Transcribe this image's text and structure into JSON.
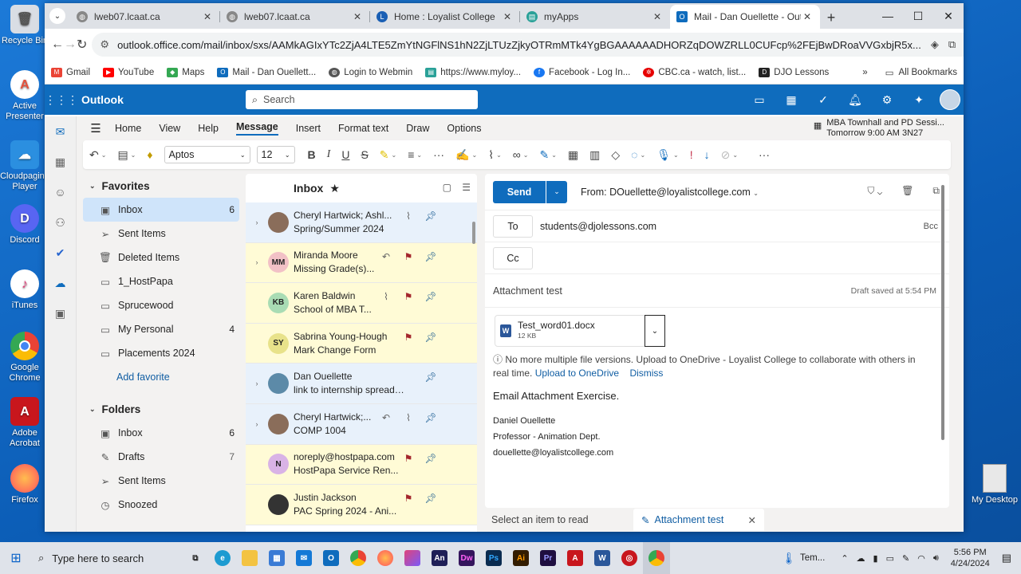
{
  "desktop": {
    "icons": [
      {
        "label": "Recycle Bin",
        "color": "#d9dde4",
        "glyph": "🗑"
      },
      {
        "label": "Active Presenter",
        "color": "#e5523c",
        "glyph": "A"
      },
      {
        "label": "Cloudpaging Player",
        "color": "#2b8fe0",
        "glyph": "☁"
      },
      {
        "label": "Discord",
        "color": "#5865f2",
        "glyph": "D"
      },
      {
        "label": "iTunes",
        "color": "#f0f0f0",
        "glyph": "♪"
      },
      {
        "label": "Google Chrome",
        "color": "#e8453c",
        "glyph": "●"
      },
      {
        "label": "Adobe Acrobat",
        "color": "#c8161d",
        "glyph": "A"
      },
      {
        "label": "Firefox",
        "color": "#ff7139",
        "glyph": "●"
      }
    ],
    "right_icon": "My Desktop"
  },
  "browser": {
    "tabs": [
      {
        "title": "lweb07.lcaat.ca",
        "color": "#888"
      },
      {
        "title": "lweb07.lcaat.ca",
        "color": "#888"
      },
      {
        "title": "Home : Loyalist College",
        "color": "#1a5fb4"
      },
      {
        "title": "myApps",
        "color": "#2aa198"
      },
      {
        "title": "Mail - Dan Ouellette - Outlo",
        "color": "#0f6cbd"
      }
    ],
    "url": "outlook.office.com/mail/inbox/sxs/AAMkAGIxYTc2ZjA4LTE5ZmYtNGFlNS1hN2ZjLTUzZjkyOTRmMTk4YgBGAAAAAADHORZqDOWZRLL0CUFcp%2FEjBwDRoaVVGxbjR5x...",
    "bookmarks": [
      {
        "label": "Gmail",
        "color": "#ea4335"
      },
      {
        "label": "YouTube",
        "color": "#ff0000"
      },
      {
        "label": "Maps",
        "color": "#34a853"
      },
      {
        "label": "Mail - Dan Ouellett...",
        "color": "#0f6cbd"
      },
      {
        "label": "Login to Webmin",
        "color": "#555555"
      },
      {
        "label": "https://www.myloy...",
        "color": "#2aa198"
      },
      {
        "label": "Facebook - Log In...",
        "color": "#1877f2"
      },
      {
        "label": "CBC.ca - watch, list...",
        "color": "#e60000"
      },
      {
        "label": "DJO Lessons",
        "color": "#222222"
      }
    ],
    "all_bookmarks": "All Bookmarks"
  },
  "outlook": {
    "app_name": "Outlook",
    "search_placeholder": "Search",
    "ribbon_tabs": [
      "Home",
      "View",
      "Help",
      "Message",
      "Insert",
      "Format text",
      "Draw",
      "Options"
    ],
    "active_tab": "Message",
    "event": {
      "title": "MBA Townhall and PD Sessi...",
      "when": "Tomorrow 9:00 AM 3N27"
    },
    "font": "Aptos",
    "font_size": "12",
    "favorites_label": "Favorites",
    "favorites": [
      {
        "label": "Inbox",
        "count": "6",
        "icon": "inbox-icon",
        "glyph": "▣"
      },
      {
        "label": "Sent Items",
        "count": "",
        "icon": "sent-icon",
        "glyph": "➢"
      },
      {
        "label": "Deleted Items",
        "count": "",
        "icon": "trash-icon",
        "glyph": "🗑"
      },
      {
        "label": "1_HostPapa",
        "count": "",
        "icon": "folder-icon",
        "glyph": "▭"
      },
      {
        "label": "Sprucewood",
        "count": "",
        "icon": "folder-icon",
        "glyph": "▭"
      },
      {
        "label": "My Personal",
        "count": "4",
        "icon": "folder-icon",
        "glyph": "▭"
      },
      {
        "label": "Placements 2024",
        "count": "",
        "icon": "folder-icon",
        "glyph": "▭"
      }
    ],
    "add_favorite": "Add favorite",
    "folders_label": "Folders",
    "folders": [
      {
        "label": "Inbox",
        "count": "6",
        "icon": "inbox-icon",
        "glyph": "▣"
      },
      {
        "label": "Drafts",
        "count": "7",
        "icon": "drafts-icon",
        "glyph": "✎"
      },
      {
        "label": "Sent Items",
        "count": "",
        "icon": "sent-icon",
        "glyph": "➢"
      },
      {
        "label": "Snoozed",
        "count": "",
        "icon": "clock-icon",
        "glyph": "◷"
      }
    ],
    "list_title": "Inbox",
    "messages": [
      {
        "from": "Cheryl Hartwick; Ashl...",
        "subject": "Spring/Summer 2024",
        "initials": "",
        "avcolor": "#8a6d5a",
        "style": "pin",
        "expand": true,
        "icons": [
          "clip",
          "pin"
        ]
      },
      {
        "from": "Miranda Moore",
        "subject": "Missing Grade(s)...",
        "initials": "MM",
        "avcolor": "#f2c1c6",
        "style": "flag",
        "expand": true,
        "icons": [
          "reply",
          "flag",
          "pin"
        ]
      },
      {
        "from": "Karen Baldwin",
        "subject": "School of MBA T...",
        "initials": "KB",
        "avcolor": "#a9dcb4",
        "style": "flag",
        "expand": false,
        "icons": [
          "clip",
          "flag",
          "pin"
        ]
      },
      {
        "from": "Sabrina Young-Hough",
        "subject": "Mark Change Form",
        "initials": "SY",
        "avcolor": "#e8e28a",
        "style": "flag",
        "expand": false,
        "icons": [
          "flag",
          "pin"
        ]
      },
      {
        "from": "Dan Ouellette",
        "subject": "link to internship spreadshe...",
        "initials": "",
        "avcolor": "#5c8aa8",
        "style": "pin",
        "expand": true,
        "icons": [
          "pin"
        ]
      },
      {
        "from": "Cheryl Hartwick;...",
        "subject": "COMP 1004",
        "initials": "",
        "avcolor": "#8a6d5a",
        "style": "pin",
        "expand": true,
        "icons": [
          "reply",
          "clip",
          "pin"
        ]
      },
      {
        "from": "noreply@hostpapa.com",
        "subject": "HostPapa Service Ren...",
        "initials": "N",
        "avcolor": "#d9b3e6",
        "style": "flag",
        "expand": false,
        "icons": [
          "flag",
          "pin"
        ]
      },
      {
        "from": "Justin Jackson",
        "subject": "PAC Spring 2024 - Ani...",
        "initials": "",
        "avcolor": "#333333",
        "style": "flag",
        "expand": false,
        "icons": [
          "flag",
          "pin"
        ]
      }
    ],
    "compose": {
      "send": "Send",
      "from": "From: DOuellette@loyalistcollege.com",
      "to_label": "To",
      "to": "students@djolessons.com",
      "bcc": "Bcc",
      "cc_label": "Cc",
      "subject": "Attachment test",
      "draft_saved": "Draft saved at 5:54 PM",
      "attachment": {
        "name": "Test_word01.docx",
        "size": "12 KB"
      },
      "notice": "No more multiple file versions. Upload to OneDrive - Loyalist College to collaborate with others in real time.",
      "upload_link": "Upload to OneDrive",
      "dismiss": "Dismiss",
      "body_heading": "Email Attachment Exercise.",
      "signature": [
        "Daniel Ouellette",
        "Professor - Animation Dept.",
        "douellette@loyalistcollege.com"
      ]
    },
    "footer": {
      "select": "Select an item to read",
      "draft_tab": "Attachment test"
    }
  },
  "taskbar": {
    "search_placeholder": "Type here to search",
    "apps": [
      {
        "label": "An",
        "color": "#1f1f57"
      },
      {
        "label": "Dw",
        "color": "#35155d"
      },
      {
        "label": "Ps",
        "color": "#0a2b50"
      },
      {
        "label": "Ai",
        "color": "#331c00"
      },
      {
        "label": "Pr",
        "color": "#1f0e40"
      }
    ],
    "tray_label": "Tem...",
    "time": "5:56 PM",
    "date": "4/24/2024"
  }
}
